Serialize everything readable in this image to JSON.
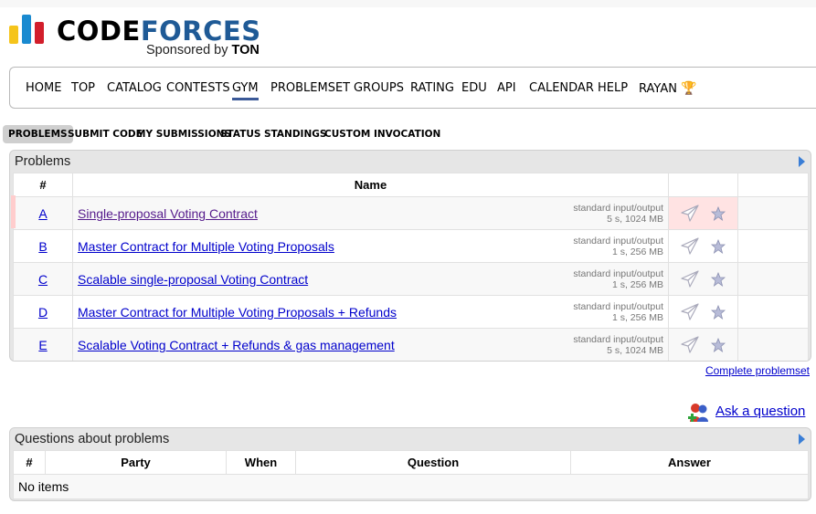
{
  "logo": {
    "word_black": "CODE",
    "word_blue": "FORCES",
    "sponsored": "Sponsored by",
    "sponsor": "TON",
    "bar_colors": [
      "#f5c41b",
      "#1a8ad0",
      "#d21e2b"
    ]
  },
  "menu": {
    "items": [
      "HOME",
      "TOP",
      "CATALOG",
      "CONTESTS",
      "GYM",
      "PROBLEMSET",
      "GROUPS",
      "RATING",
      "EDU",
      "API",
      "CALENDAR",
      "HELP",
      "RAYAN"
    ],
    "active": "GYM",
    "trophy_icon": "trophy-icon"
  },
  "submenu": {
    "items": [
      "PROBLEMS",
      "SUBMIT CODE",
      "MY SUBMISSIONS",
      "STATUS",
      "STANDINGS",
      "CUSTOM INVOCATION"
    ],
    "active": "PROBLEMS"
  },
  "problems": {
    "title": "Problems",
    "headers": {
      "index": "#",
      "name": "Name"
    },
    "rows": [
      {
        "index": "A",
        "name": "Single-proposal Voting Contract",
        "io": "standard input/output",
        "limits": "5 s, 1024 MB"
      },
      {
        "index": "B",
        "name": "Master Contract for Multiple Voting Proposals",
        "io": "standard input/output",
        "limits": "1 s, 256 MB"
      },
      {
        "index": "C",
        "name": "Scalable single-proposal Voting Contract",
        "io": "standard input/output",
        "limits": "1 s, 256 MB"
      },
      {
        "index": "D",
        "name": "Master Contract for Multiple Voting Proposals + Refunds",
        "io": "standard input/output",
        "limits": "1 s, 256 MB"
      },
      {
        "index": "E",
        "name": "Scalable Voting Contract + Refunds & gas management",
        "io": "standard input/output",
        "limits": "5 s, 1024 MB"
      }
    ],
    "complete_link": "Complete problemset"
  },
  "ask": {
    "label": "Ask a question"
  },
  "questions": {
    "title": "Questions about problems",
    "headers": [
      "#",
      "Party",
      "When",
      "Question",
      "Answer"
    ],
    "empty": "No items"
  }
}
